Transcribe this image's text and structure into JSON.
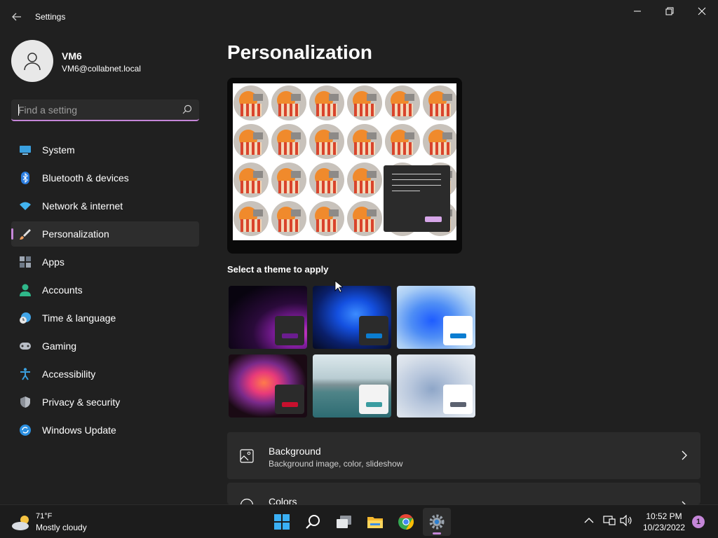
{
  "window": {
    "title": "Settings"
  },
  "profile": {
    "name": "VM6",
    "email": "VM6@collabnet.local"
  },
  "search": {
    "placeholder": "Find a setting",
    "value": ""
  },
  "sidebar": {
    "items": [
      {
        "label": "System",
        "icon": "monitor-icon",
        "active": false
      },
      {
        "label": "Bluetooth & devices",
        "icon": "bluetooth-icon",
        "active": false
      },
      {
        "label": "Network & internet",
        "icon": "wifi-icon",
        "active": false
      },
      {
        "label": "Personalization",
        "icon": "brush-icon",
        "active": true
      },
      {
        "label": "Apps",
        "icon": "apps-icon",
        "active": false
      },
      {
        "label": "Accounts",
        "icon": "person-icon",
        "active": false
      },
      {
        "label": "Time & language",
        "icon": "clock-globe-icon",
        "active": false
      },
      {
        "label": "Gaming",
        "icon": "gamepad-icon",
        "active": false
      },
      {
        "label": "Accessibility",
        "icon": "accessibility-icon",
        "active": false
      },
      {
        "label": "Privacy & security",
        "icon": "shield-icon",
        "active": false
      },
      {
        "label": "Windows Update",
        "icon": "update-icon",
        "active": false
      }
    ]
  },
  "main": {
    "title": "Personalization",
    "themes_label": "Select a theme to apply",
    "themes": [
      {
        "name": "glow-dark",
        "accent": "#6b1d8f"
      },
      {
        "name": "bloom-dark",
        "accent": "#0b7dd1"
      },
      {
        "name": "bloom-light",
        "accent": "#0b7dd1"
      },
      {
        "name": "captured-motion",
        "accent": "#c8102e"
      },
      {
        "name": "sunrise-lake",
        "accent": "#3a9ca0"
      },
      {
        "name": "flow",
        "accent": "#5c6270"
      }
    ],
    "cards": [
      {
        "title": "Background",
        "subtitle": "Background image, color, slideshow",
        "icon": "image-icon"
      },
      {
        "title": "Colors",
        "subtitle": "",
        "icon": "palette-icon"
      }
    ]
  },
  "taskbar": {
    "weather": {
      "temp": "71°F",
      "desc": "Mostly cloudy"
    },
    "apps": [
      "start-icon",
      "search-icon",
      "task-view-icon",
      "file-explorer-icon",
      "chrome-icon",
      "settings-icon"
    ],
    "time": "10:52 PM",
    "date": "10/23/2022",
    "notifications": "1"
  },
  "colors": {
    "accent": "#c586d8",
    "background": "#202020",
    "card": "#2b2b2b"
  }
}
